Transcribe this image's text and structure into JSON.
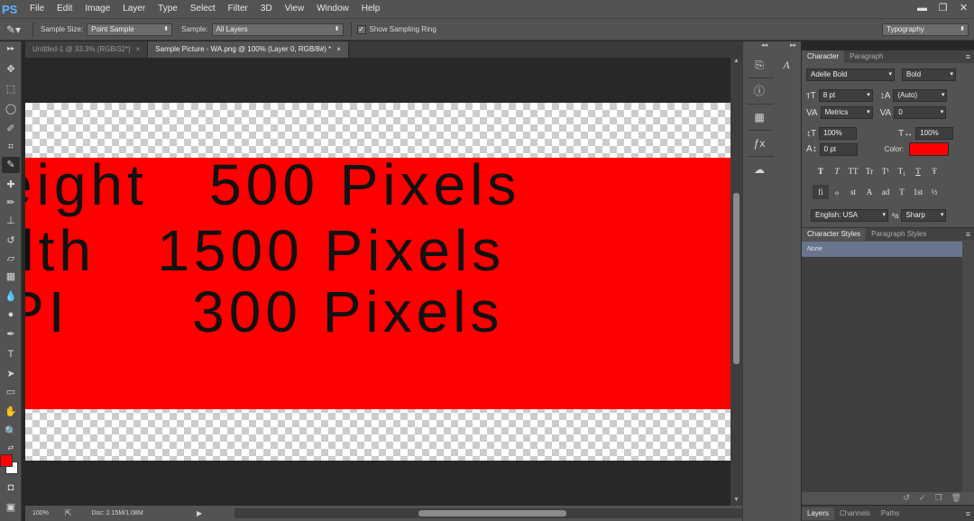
{
  "app": {
    "logo": "PS",
    "colors": {
      "accent_red": "#ff0000",
      "ui_dark": "#535353",
      "selection": "#68758d"
    }
  },
  "menu": {
    "items": [
      "File",
      "Edit",
      "Image",
      "Layer",
      "Type",
      "Select",
      "Filter",
      "3D",
      "View",
      "Window",
      "Help"
    ]
  },
  "window_controls": {
    "minimize": "▬",
    "restore": "❐",
    "close": "✕"
  },
  "options": {
    "sample_size_label": "Sample Size:",
    "sample_size_value": "Point Sample",
    "sample_label": "Sample:",
    "sample_value": "All Layers",
    "show_ring_label": "Show Sampling Ring",
    "show_ring_checked": true,
    "workspace": "Typography"
  },
  "tabs": [
    {
      "label": "Untitled-1 @ 33.3% (RGB/32*)",
      "close": "×"
    },
    {
      "label": "Sample Picture - WA.png @ 100% (Layer 0, RGB/8#) *",
      "close": "×"
    }
  ],
  "canvas": {
    "lines": [
      "eight   500 Pixels",
      "dth   1500 Pixels",
      "PI      300 Pixels"
    ],
    "band_color": "#ff0000"
  },
  "status": {
    "zoom": "100%",
    "doc_info": "Doc: 2.15M/1.08M"
  },
  "character_panel": {
    "tabs": [
      "Character",
      "Paragraph"
    ],
    "font_family": "Adelle Bold",
    "font_style": "Bold",
    "font_size": "8 pt",
    "leading": "(Auto)",
    "kerning": "Metrics",
    "tracking": "0",
    "vertical_scale": "100%",
    "horizontal_scale": "100%",
    "baseline_shift": "0 pt",
    "color_label": "Color:",
    "color": "#ff0000",
    "type_buttons": [
      "T",
      "T",
      "TT",
      "Tr",
      "T¹",
      "T₁",
      "T",
      "Ŧ"
    ],
    "opentype_buttons": [
      "fi",
      "ℴ",
      "st",
      "A",
      "ad",
      "T",
      "1st",
      "½"
    ],
    "language": "English: USA",
    "aa_label": "ªa",
    "antialias": "Sharp"
  },
  "character_styles_panel": {
    "tabs": [
      "Character Styles",
      "Paragraph Styles"
    ],
    "items": [
      "None"
    ]
  },
  "layers_tabs": [
    "Layers",
    "Channels",
    "Paths"
  ]
}
